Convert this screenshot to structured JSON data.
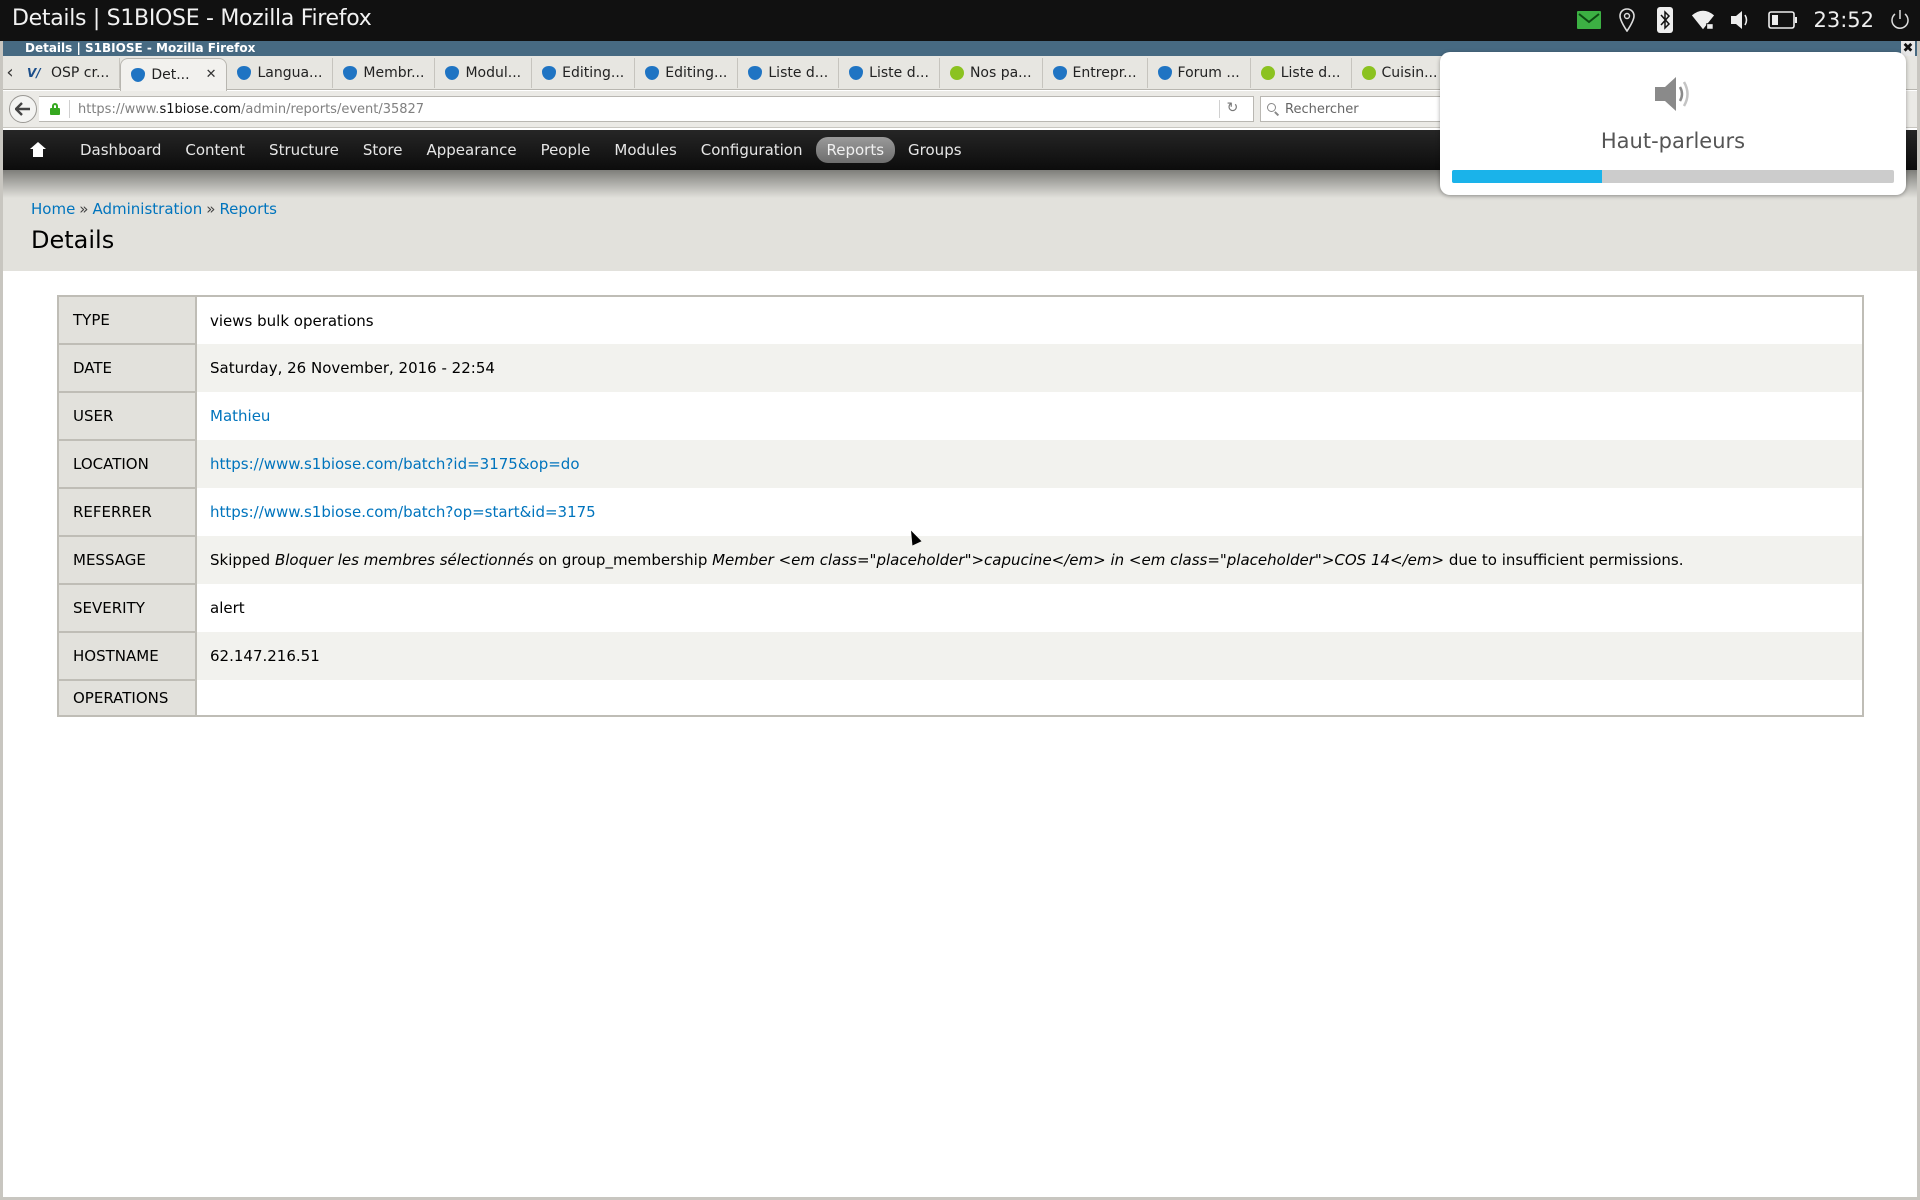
{
  "os": {
    "window_title": "Details | S1BIOSE - Mozilla Firefox",
    "clock": "23:52",
    "tray_icons": [
      "mail-icon",
      "location-icon",
      "bluetooth-icon",
      "wifi-icon",
      "volume-icon",
      "battery-icon",
      "power-icon"
    ]
  },
  "browser": {
    "window_title": "Details | S1BIOSE - Mozilla Firefox",
    "tabs": [
      {
        "label": "OSP cr...",
        "icon": "osp-favicon"
      },
      {
        "label": "Det...",
        "icon": "drupal-favicon",
        "active": true
      },
      {
        "label": "Langua...",
        "icon": "drupal-favicon"
      },
      {
        "label": "Membr...",
        "icon": "drupal-favicon"
      },
      {
        "label": "Modul...",
        "icon": "drupal-favicon"
      },
      {
        "label": "Editing...",
        "icon": "drupal-favicon"
      },
      {
        "label": "Editing...",
        "icon": "drupal-favicon"
      },
      {
        "label": "Liste d...",
        "icon": "drupal-favicon"
      },
      {
        "label": "Liste d...",
        "icon": "drupal-favicon"
      },
      {
        "label": "Nos pa...",
        "icon": "green-favicon"
      },
      {
        "label": "Entrepr...",
        "icon": "drupal-favicon"
      },
      {
        "label": "Forum ...",
        "icon": "drupal-favicon"
      },
      {
        "label": "Liste d...",
        "icon": "green-favicon"
      },
      {
        "label": "Cuisin...",
        "icon": "green-favicon"
      },
      {
        "label": "",
        "icon": "drupal-favicon"
      }
    ],
    "url": {
      "prefix": "https://www.",
      "domain": "s1biose.com",
      "path": "/admin/reports/event/35827"
    },
    "search_placeholder": "Rechercher"
  },
  "admin_nav": {
    "items": [
      "Dashboard",
      "Content",
      "Structure",
      "Store",
      "Appearance",
      "People",
      "Modules",
      "Configuration",
      "Reports",
      "Groups"
    ],
    "active": "Reports"
  },
  "page": {
    "breadcrumb": [
      "Home",
      "Administration",
      "Reports"
    ],
    "breadcrumb_separator": "»",
    "title": "Details"
  },
  "details": {
    "type": {
      "label": "TYPE",
      "value": "views bulk operations"
    },
    "date": {
      "label": "DATE",
      "value": "Saturday, 26 November, 2016 - 22:54"
    },
    "user": {
      "label": "USER",
      "value": "Mathieu"
    },
    "location": {
      "label": "LOCATION",
      "value": "https://www.s1biose.com/batch?id=3175&op=do"
    },
    "referrer": {
      "label": "REFERRER",
      "value": "https://www.s1biose.com/batch?op=start&id=3175"
    },
    "message": {
      "label": "MESSAGE",
      "part1": "Skipped ",
      "em1": "Bloquer les membres sélectionnés",
      "part2": " on group_membership ",
      "em2": "Member <em class=\"placeholder\">capucine</em> in <em class=\"placeholder\">COS 14</em>",
      "part3": " due to insufficient permissions."
    },
    "severity": {
      "label": "SEVERITY",
      "value": "alert"
    },
    "hostname": {
      "label": "HOSTNAME",
      "value": "62.147.216.51"
    },
    "operations": {
      "label": "OPERATIONS",
      "value": ""
    }
  },
  "volume_popup": {
    "label": "Haut-parleurs",
    "level_percent": 34,
    "accent": "#1ab3ea"
  }
}
